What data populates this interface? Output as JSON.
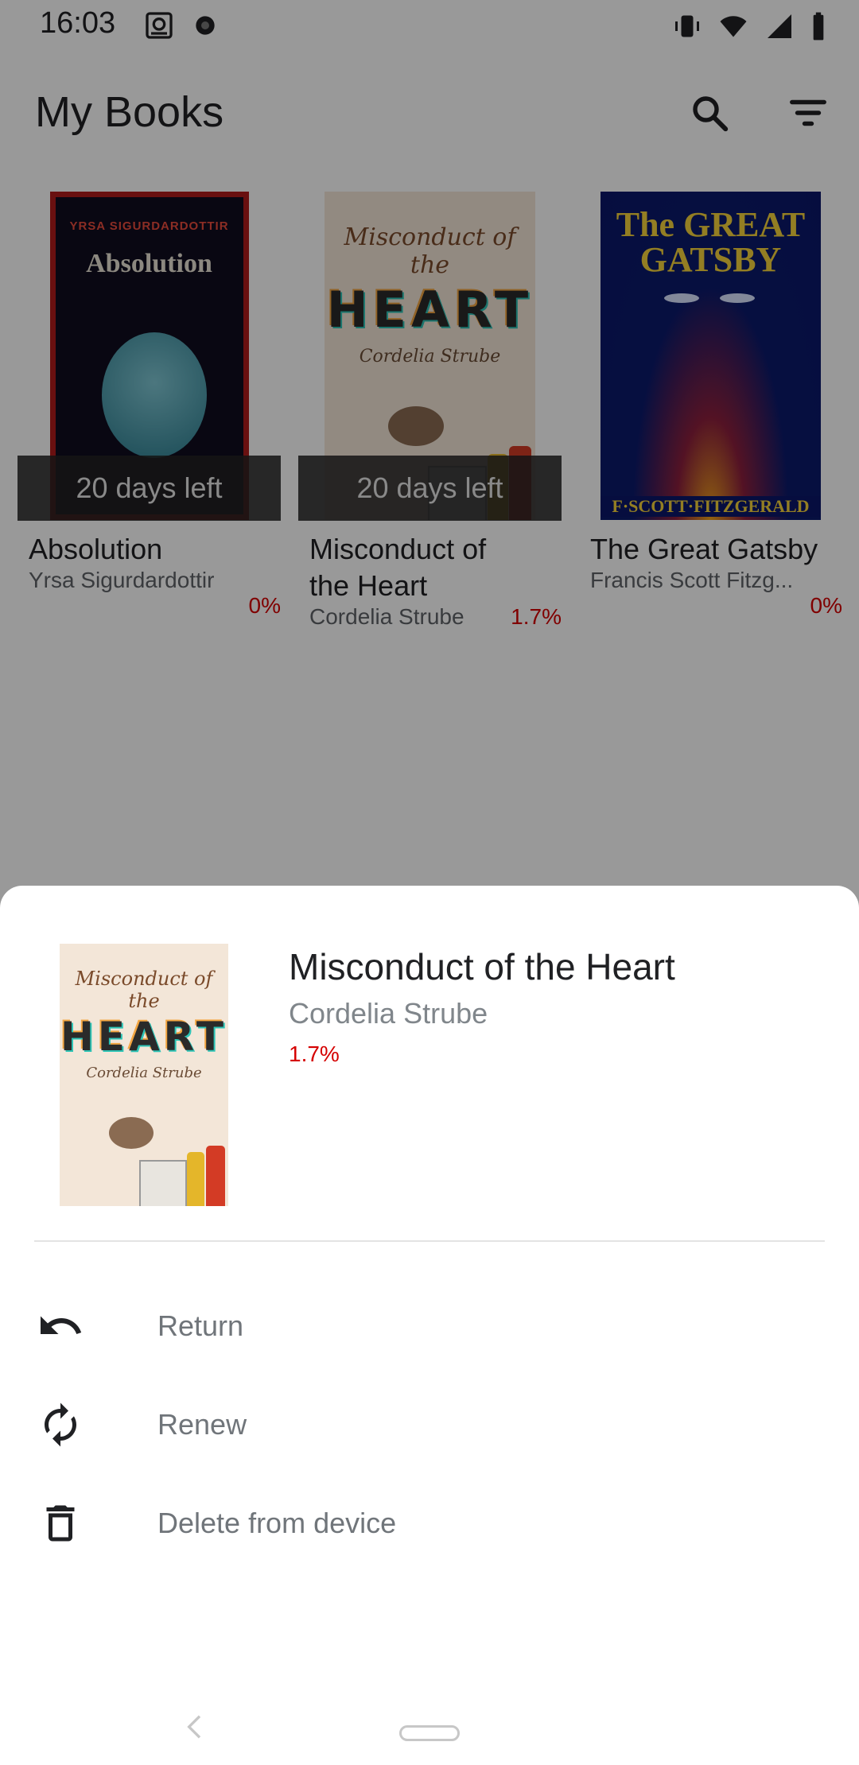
{
  "status_bar": {
    "time": "16:03",
    "left_icons": [
      "storage-icon",
      "settings-gear-icon"
    ],
    "right_icons": [
      "vibrate-icon",
      "wifi-icon",
      "signal-icon",
      "battery-icon"
    ]
  },
  "app_bar": {
    "title": "My Books",
    "search_icon": "search-icon",
    "filter_icon": "filter-icon"
  },
  "books": [
    {
      "title": "Absolution",
      "author": "Yrsa Sigurdardottir",
      "progress": "0%",
      "badge": "20 days left",
      "cover_author": "YRSA SIGURDARDOTTIR",
      "cover_title": "Absolution"
    },
    {
      "title": "Misconduct of the Heart",
      "author": "Cordelia Strube",
      "progress": "1.7%",
      "badge": "20 days left",
      "cover_title1": "Misconduct of the",
      "cover_heart": "HEART",
      "cover_author": "Cordelia Strube"
    },
    {
      "title": "The Great Gatsby",
      "author": "Francis Scott Fitzg...",
      "progress": "0%",
      "cover_title": "The GREAT GATSBY",
      "cover_author": "F·SCOTT·FITZGERALD"
    }
  ],
  "sheet": {
    "title": "Misconduct of the Heart",
    "author": "Cordelia Strube",
    "progress": "1.7%",
    "cover_title1": "Misconduct of the",
    "cover_heart": "HEART",
    "cover_author": "Cordelia Strube",
    "actions": [
      {
        "label": "Return",
        "icon": "return-icon"
      },
      {
        "label": "Renew",
        "icon": "renew-icon"
      },
      {
        "label": "Delete from device",
        "icon": "delete-icon"
      }
    ]
  },
  "colors": {
    "progress_red": "#d50000",
    "scrim": "rgba(0,0,0,0.40)"
  }
}
